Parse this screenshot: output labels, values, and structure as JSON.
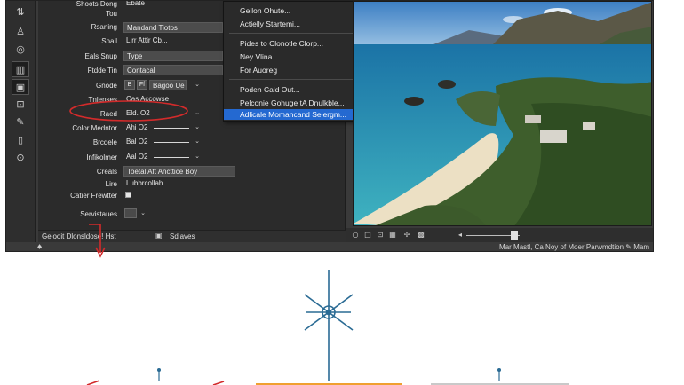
{
  "properties": [
    {
      "label": "Shoots Dong",
      "value": "Ebate",
      "style": "plain"
    },
    {
      "label": "Tou",
      "value": "",
      "style": "plain"
    },
    {
      "label": "Rsaning",
      "value": "Mandand Tiotos",
      "style": "field"
    },
    {
      "label": "Spail",
      "value": "Lirr Attir Cb...",
      "style": "plain"
    },
    {
      "label": "Eals Snup",
      "value": "Type",
      "style": "field"
    },
    {
      "label": "Ftdde Tin",
      "value": "Contacal",
      "style": "field"
    },
    {
      "label": "Gnode",
      "value": "Bagoo Ue",
      "style": "boxes"
    },
    {
      "label": "Tnlenses",
      "value": "Cas Accowse",
      "style": "plain"
    },
    {
      "label": "Raed",
      "value": "Eld. O2",
      "style": "line"
    },
    {
      "label": "Color Medntor",
      "value": "Ahi O2",
      "style": "line"
    },
    {
      "label": "Brcdele",
      "value": "Bal O2",
      "style": "line"
    },
    {
      "label": "Infikolmer",
      "value": "Aal O2",
      "style": "line"
    },
    {
      "label": "Creals",
      "value": "Toetal Aft Ancttice Boy",
      "style": "field"
    },
    {
      "label": "Lire",
      "value": "Lubbrcollah",
      "style": "plain"
    },
    {
      "label": "Catier Frewtter",
      "value": "",
      "style": "checkbox"
    },
    {
      "label": "Servistaues",
      "value": "_",
      "style": "plain"
    }
  ],
  "status_bar": {
    "left_text": "Gelooit Dlonsldose! Hst",
    "right_text": "Sdlaves"
  },
  "context_menu": {
    "items": [
      {
        "label": "Geilon Ohute...",
        "highlighted": false,
        "submenu": false
      },
      {
        "label": "Actielly Startemi...",
        "highlighted": false,
        "submenu": false
      },
      {
        "label": "Pides to Clonotle Clorp...",
        "highlighted": false,
        "submenu": false
      },
      {
        "label": "Ney Vlina.",
        "highlighted": false,
        "submenu": false
      },
      {
        "label": "For Auoreg",
        "highlighted": false,
        "submenu": true
      },
      {
        "label": "Poden Cald Out...",
        "highlighted": false,
        "submenu": false
      },
      {
        "label": "Pelconie Gohuge tA Dnulkble...",
        "highlighted": false,
        "submenu": false
      },
      {
        "label": "Adlicale Momancand Selergm...",
        "highlighted": true,
        "submenu": false
      }
    ]
  },
  "footer_text": "Mar Mastl, Ca Noy of Moer Parwmdtion ✎ Mam",
  "icons": {
    "tools": [
      "transform-icon",
      "stamp-icon",
      "target-icon",
      "layers-icon",
      "image-icon",
      "select-icon",
      "brush-icon",
      "book-icon",
      "zoom-icon"
    ],
    "viewer": [
      "circle-icon",
      "square-icon",
      "frame-icon",
      "layers-icon",
      "pin-icon",
      "grid-icon"
    ]
  },
  "colors": {
    "highlight": "#2469d1",
    "annotation_red": "#d22b2b",
    "diagram_blue": "#2a6b94",
    "diagram_orange": "#f0a030"
  }
}
